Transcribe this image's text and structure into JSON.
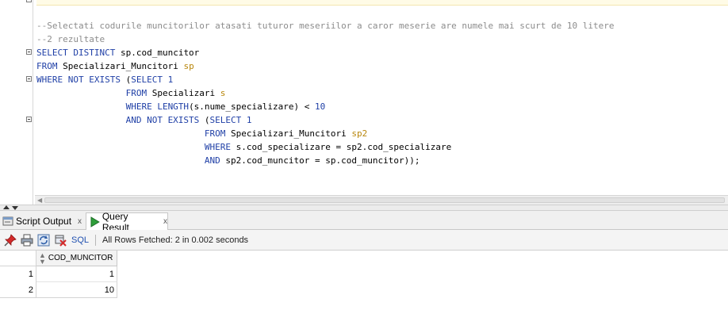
{
  "editor": {
    "lines": [
      {
        "tokens": [
          {
            "t": "--Selectati codurile muncitorilor atasati tuturor meseriilor a caror meserie are numele mai scurt de 10 litere",
            "c": "cm"
          }
        ]
      },
      {
        "tokens": [
          {
            "t": "--2 rezultate",
            "c": "cm"
          }
        ]
      },
      {
        "tokens": [
          {
            "t": "SELECT DISTINCT ",
            "c": "kw"
          },
          {
            "t": "sp.cod_muncitor",
            "c": "tx"
          }
        ]
      },
      {
        "tokens": [
          {
            "t": "FROM ",
            "c": "kw"
          },
          {
            "t": "Specializari_Muncitori ",
            "c": "tx"
          },
          {
            "t": "sp",
            "c": "al"
          }
        ]
      },
      {
        "tokens": [
          {
            "t": "WHERE NOT EXISTS ",
            "c": "kw"
          },
          {
            "t": "(",
            "c": "tx"
          },
          {
            "t": "SELECT 1",
            "c": "kw"
          }
        ]
      },
      {
        "tokens": [
          {
            "t": "                 FROM ",
            "c": "kw"
          },
          {
            "t": "Specializari ",
            "c": "tx"
          },
          {
            "t": "s",
            "c": "al"
          }
        ]
      },
      {
        "tokens": [
          {
            "t": "                 WHERE LENGTH",
            "c": "kw"
          },
          {
            "t": "(s.nume_specializare) < ",
            "c": "tx"
          },
          {
            "t": "10",
            "c": "kw"
          }
        ]
      },
      {
        "tokens": [
          {
            "t": "                 AND NOT EXISTS ",
            "c": "kw"
          },
          {
            "t": "(",
            "c": "tx"
          },
          {
            "t": "SELECT 1",
            "c": "kw"
          }
        ]
      },
      {
        "tokens": [
          {
            "t": "                                FROM ",
            "c": "kw"
          },
          {
            "t": "Specializari_Muncitori ",
            "c": "tx"
          },
          {
            "t": "sp2",
            "c": "al"
          }
        ]
      },
      {
        "tokens": [
          {
            "t": "                                WHERE ",
            "c": "kw"
          },
          {
            "t": "s.cod_specializare = sp2.cod_specializare",
            "c": "tx"
          }
        ]
      },
      {
        "tokens": [
          {
            "t": "                                AND ",
            "c": "kw"
          },
          {
            "t": "sp2.cod_muncitor = sp.cod_muncitor));",
            "c": "tx"
          }
        ]
      }
    ]
  },
  "tabs": [
    {
      "label": "Script Output",
      "close": "x"
    },
    {
      "label": "Query Result",
      "close": "x"
    }
  ],
  "toolbar": {
    "sql_label": "SQL",
    "status": "All Rows Fetched: 2 in 0.002 seconds",
    "icons": [
      "pin-icon",
      "print-icon",
      "refresh-icon",
      "delete-icon"
    ]
  },
  "grid": {
    "column": "COD_MUNCITOR",
    "rows": [
      {
        "num": "1",
        "value": "1"
      },
      {
        "num": "2",
        "value": "10"
      }
    ]
  },
  "colors": {
    "keyword": "#1f3fa6",
    "comment": "#8c8c8c",
    "alias": "#b8860b",
    "link": "#2050b0"
  }
}
